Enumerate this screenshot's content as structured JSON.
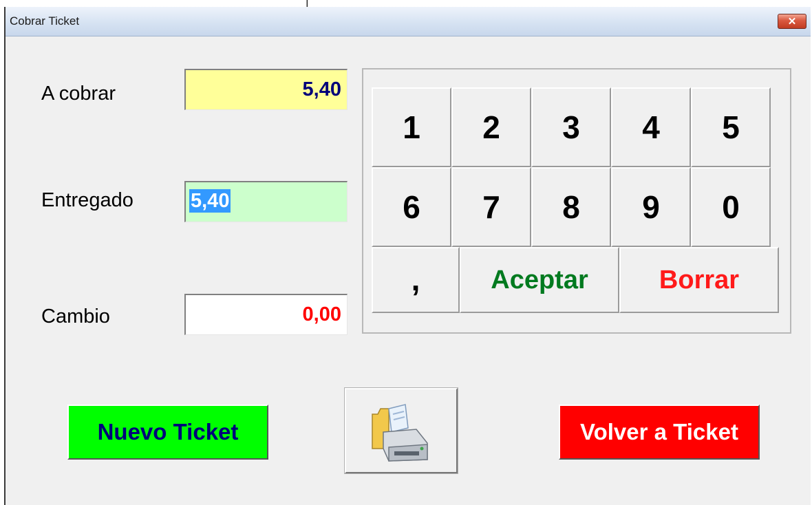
{
  "top_glyph": "|",
  "window": {
    "title": "Cobrar Ticket",
    "close_icon": "close-icon"
  },
  "fields": {
    "a_cobrar": {
      "label": "A cobrar",
      "value": "5,40",
      "bg": "#ffff99",
      "color": "#00007a"
    },
    "entregado": {
      "label": "Entregado",
      "value": "5,40",
      "bg": "#ccffcc",
      "color": "#ffffff",
      "selection": "#3399ff"
    },
    "cambio": {
      "label": "Cambio",
      "value": "0,00",
      "bg": "#ffffff",
      "color": "#ff0000"
    }
  },
  "keypad": {
    "digits_row1": [
      "1",
      "2",
      "3",
      "4",
      "5"
    ],
    "digits_row2": [
      "6",
      "7",
      "8",
      "9",
      "0"
    ],
    "comma": ",",
    "aceptar": "Aceptar",
    "borrar": "Borrar",
    "aceptar_color": "#007a1f",
    "borrar_color": "#ff1a1a"
  },
  "buttons": {
    "nuevo_ticket": {
      "label": "Nuevo Ticket",
      "bg": "#00ff00",
      "color": "#00007a"
    },
    "print": {
      "icon": "printer-icon"
    },
    "volver_ticket": {
      "label": "Volver a Ticket",
      "bg": "#ff0000",
      "color": "#ffffff"
    }
  }
}
